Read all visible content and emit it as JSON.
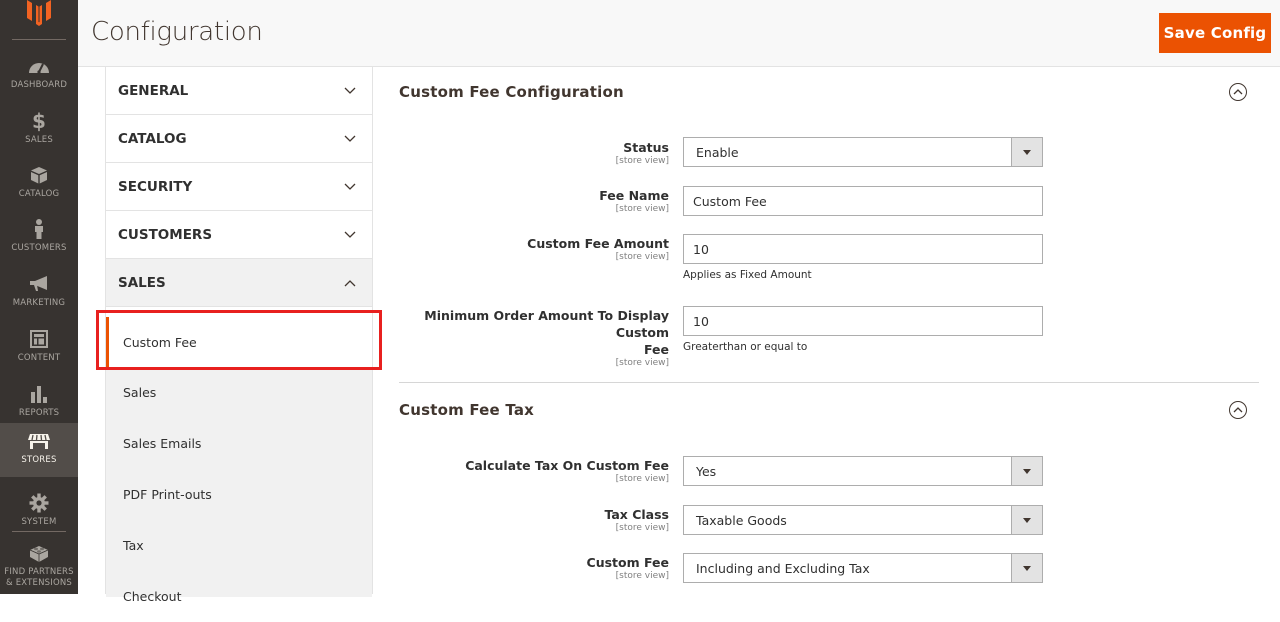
{
  "nav": {
    "items": [
      {
        "label": "DASHBOARD",
        "icon": "dashboard-icon"
      },
      {
        "label": "SALES",
        "icon": "dollar-icon"
      },
      {
        "label": "CATALOG",
        "icon": "box-icon"
      },
      {
        "label": "CUSTOMERS",
        "icon": "person-icon"
      },
      {
        "label": "MARKETING",
        "icon": "megaphone-icon"
      },
      {
        "label": "CONTENT",
        "icon": "layout-icon"
      },
      {
        "label": "REPORTS",
        "icon": "bar-chart-icon"
      },
      {
        "label": "STORES",
        "icon": "store-icon"
      },
      {
        "label": "SYSTEM",
        "icon": "gear-icon"
      },
      {
        "label": "FIND PARTNERS & EXTENSIONS",
        "icon": "lego-brick-icon"
      }
    ],
    "active": "STORES"
  },
  "header": {
    "title": "Configuration",
    "save_label": "Save Config"
  },
  "colors": {
    "accent": "#eb5202",
    "nav_bg": "#373330",
    "highlight": "#e8201f"
  },
  "tabs": {
    "groups": [
      {
        "label": "GENERAL",
        "expanded": false
      },
      {
        "label": "CATALOG",
        "expanded": false
      },
      {
        "label": "SECURITY",
        "expanded": false
      },
      {
        "label": "CUSTOMERS",
        "expanded": false
      },
      {
        "label": "SALES",
        "expanded": true
      }
    ],
    "sales_items": [
      "Custom Fee",
      "Sales",
      "Sales Emails",
      "PDF Print-outs",
      "Tax",
      "Checkout"
    ],
    "active_item": "Custom Fee"
  },
  "sections": {
    "config": {
      "title": "Custom Fee Configuration",
      "fields": [
        {
          "label": "Status",
          "scope": "[store view]",
          "type": "select",
          "value": "Enable"
        },
        {
          "label": "Fee Name",
          "scope": "[store view]",
          "type": "text",
          "value": "Custom Fee"
        },
        {
          "label": "Custom Fee Amount",
          "scope": "[store view]",
          "type": "text",
          "value": "10",
          "note": "Applies as Fixed Amount"
        },
        {
          "label": "Minimum Order Amount To Display Custom Fee",
          "label_line1": "Minimum Order Amount To Display Custom",
          "label_line2": "Fee",
          "scope": "[store view]",
          "type": "text",
          "value": "10",
          "note": "Greaterthan or equal to"
        }
      ]
    },
    "tax": {
      "title": "Custom Fee Tax",
      "fields": [
        {
          "label": "Calculate Tax On Custom Fee",
          "scope": "[store view]",
          "type": "select",
          "value": "Yes"
        },
        {
          "label": "Tax Class",
          "scope": "[store view]",
          "type": "select",
          "value": "Taxable Goods"
        },
        {
          "label": "Custom Fee",
          "scope": "[store view]",
          "type": "select",
          "value": "Including and Excluding Tax"
        }
      ]
    }
  }
}
